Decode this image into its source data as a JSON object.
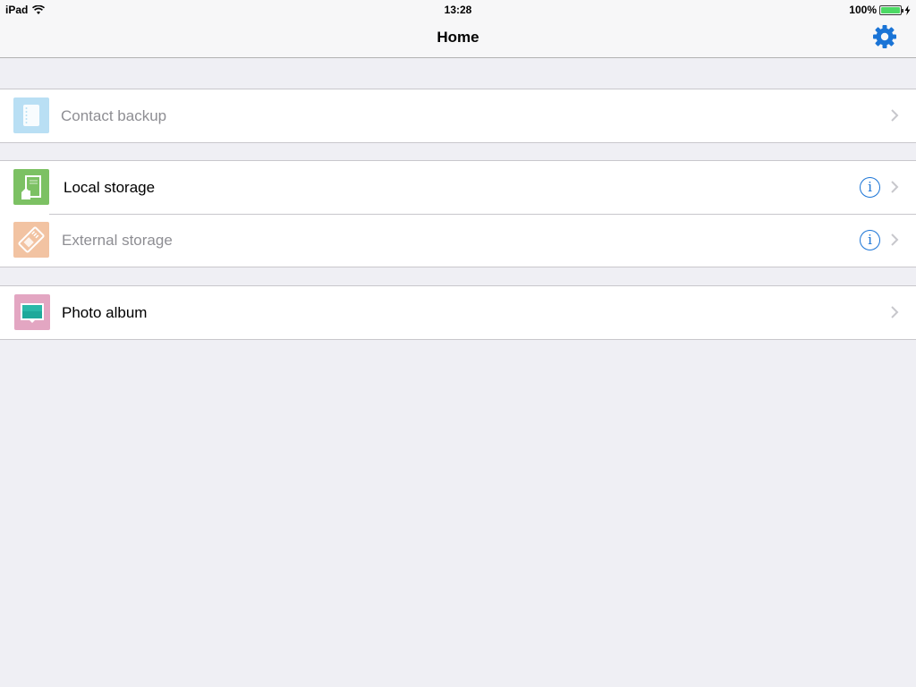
{
  "status_bar": {
    "device": "iPad",
    "time": "13:28",
    "battery_percent": "100%",
    "battery_level": 1.0
  },
  "nav": {
    "title": "Home",
    "settings_icon": "gear-icon"
  },
  "colors": {
    "accent": "#1a74d6",
    "background": "#efeff4",
    "contact_icon_bg": "#b9dff4",
    "local_icon_bg": "#7cc163",
    "external_icon_bg": "#f2c3a2",
    "photo_icon_bg": "#e3a6c2"
  },
  "items": {
    "contact_backup": {
      "label": "Contact backup",
      "icon": "notebook-icon",
      "enabled": false
    },
    "local_storage": {
      "label": "Local storage",
      "icon": "device-storage-icon",
      "enabled": true
    },
    "external_storage": {
      "label": "External storage",
      "icon": "sd-card-icon",
      "enabled": false
    },
    "photo_album": {
      "label": "Photo album",
      "icon": "photo-icon",
      "enabled": true
    }
  },
  "info_label": "i"
}
